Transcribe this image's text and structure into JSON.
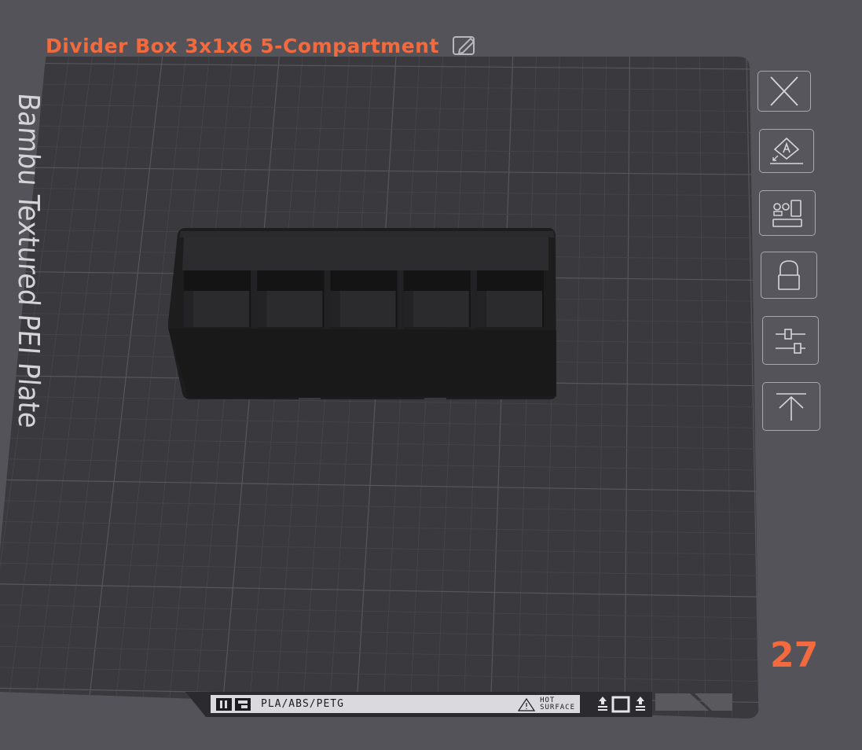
{
  "plate": {
    "title": "Divider Box 3x1x6 5-Compartment",
    "bed_label": "Bambu Textured PEI Plate",
    "index": "27",
    "accent_color": "#f26a3e"
  },
  "toolbar": {
    "buttons": [
      {
        "name": "close-plate-button",
        "icon": "close-icon"
      },
      {
        "name": "auto-orient-button",
        "icon": "auto-orient-icon"
      },
      {
        "name": "arrange-button",
        "icon": "arrange-icon"
      },
      {
        "name": "lock-plate-button",
        "icon": "lock-icon"
      },
      {
        "name": "plate-settings-button",
        "icon": "settings-sliders-icon"
      },
      {
        "name": "move-to-top-button",
        "icon": "move-to-top-icon"
      }
    ]
  },
  "bed_strip": {
    "materials": "PLA/ABS/PETG",
    "warning_line1": "HOT",
    "warning_line2": "SURFACE"
  },
  "model": {
    "compartments": 5,
    "color": "#1d1d1e"
  }
}
